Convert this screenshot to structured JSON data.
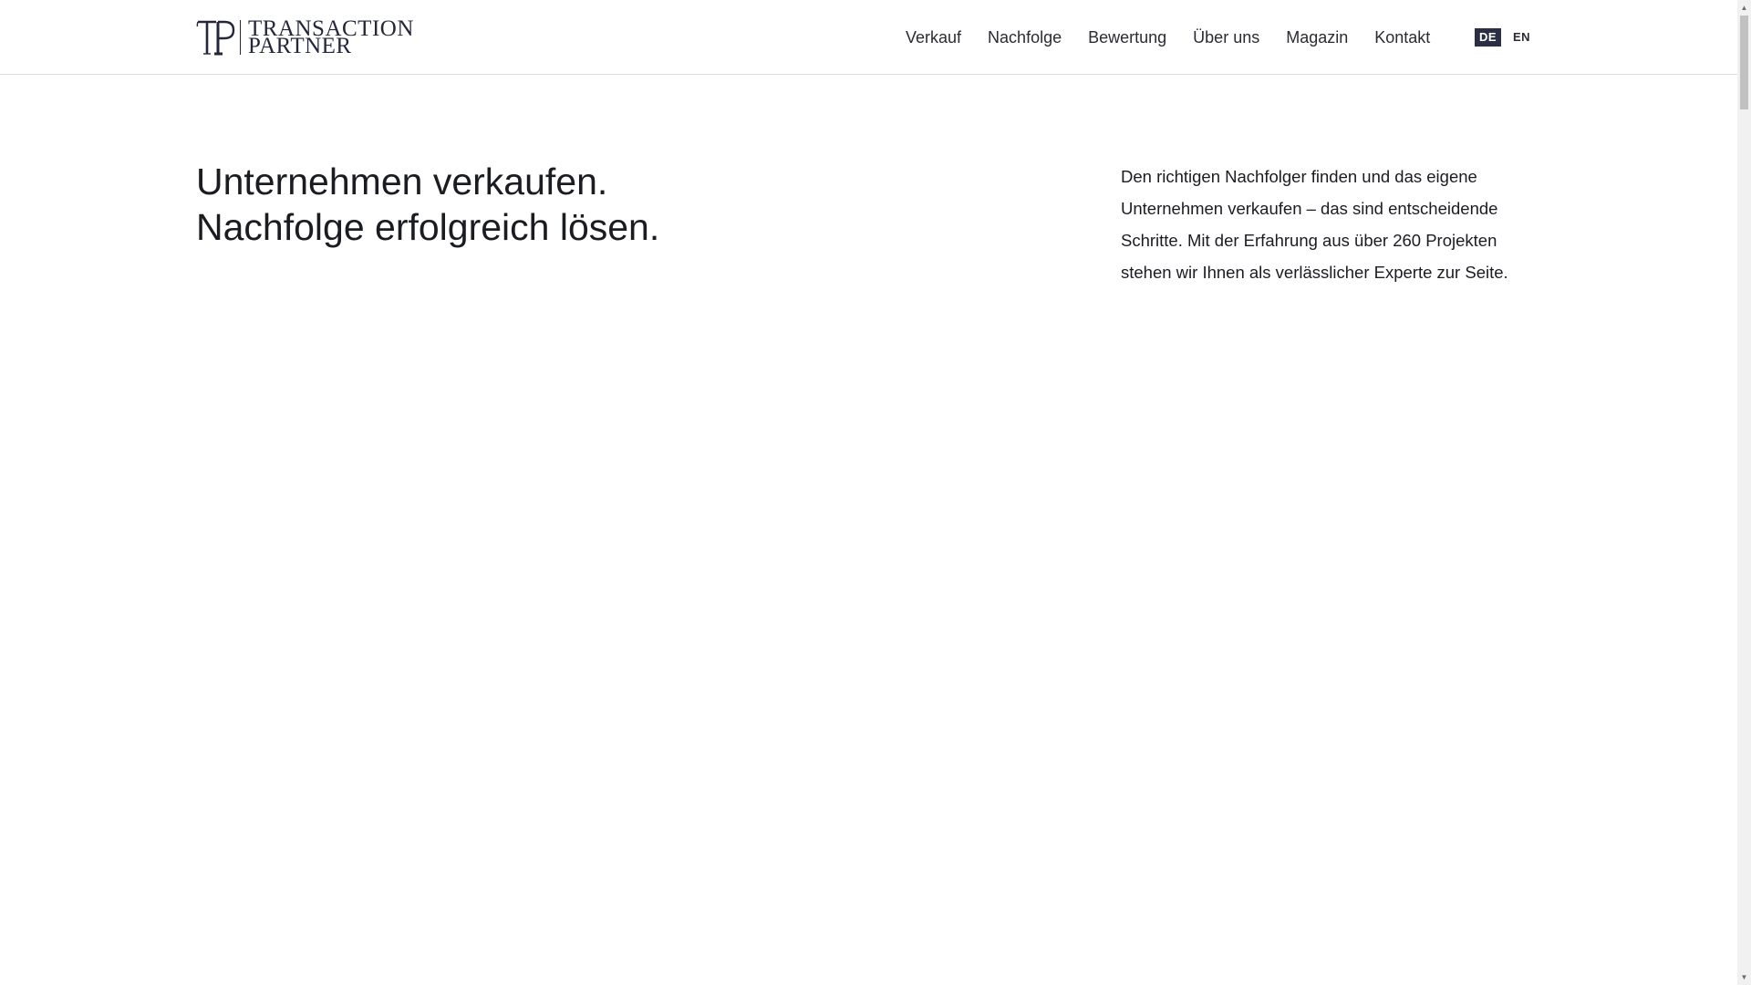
{
  "header": {
    "logo": {
      "line1": "TRANSACTION",
      "line2": "PARTNER",
      "icon": "tp-monogram-icon"
    },
    "nav": [
      {
        "label": "Verkauf"
      },
      {
        "label": "Nachfolge"
      },
      {
        "label": "Bewertung"
      },
      {
        "label": "Über uns"
      },
      {
        "label": "Magazin"
      },
      {
        "label": "Kontakt"
      }
    ],
    "languages": {
      "active": "DE",
      "inactive": "EN"
    }
  },
  "hero": {
    "headline_line1": "Unternehmen verkaufen.",
    "headline_line2": "Nachfolge erfolgreich lösen.",
    "intro": "Den richtigen Nachfolger finden und das eigene Unternehmen verkaufen – das sind entscheidende Schritte. Mit der Erfahrung aus über 260 Projekten stehen wir Ihnen als verlässlicher Experte zur Seite."
  },
  "colors": {
    "brand_navy": "#2b2f44",
    "text": "#1b1c22",
    "header_border": "#dcdcdc"
  },
  "scrollbar": {
    "up_icon": "scroll-up-arrow-icon",
    "down_icon": "scroll-down-arrow-icon"
  }
}
